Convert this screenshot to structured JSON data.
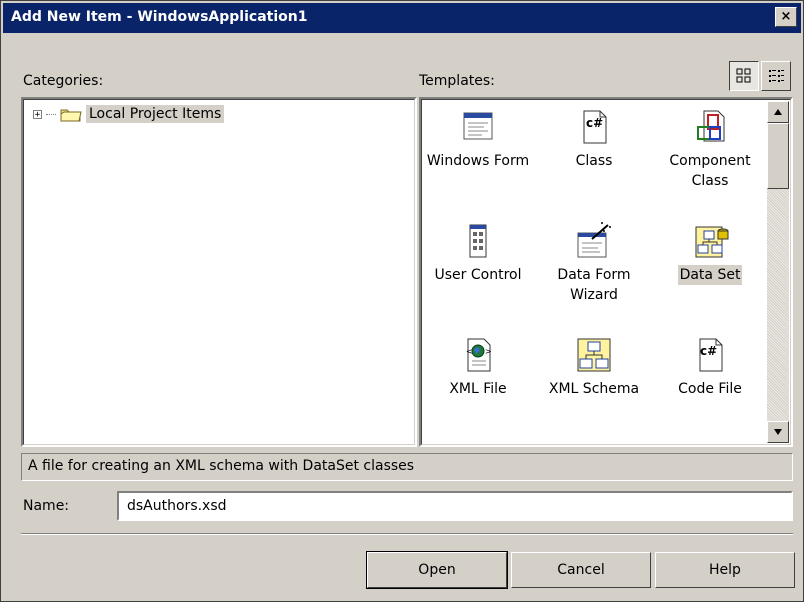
{
  "window": {
    "title": "Add New Item - WindowsApplication1",
    "close_label": "×"
  },
  "categories": {
    "label": "Categories:",
    "items": [
      {
        "label": "Local Project Items",
        "expander": "+",
        "icon": "folder-icon"
      }
    ]
  },
  "templates": {
    "label": "Templates:",
    "view_buttons": [
      {
        "name": "large-icons-view",
        "icon": "large-icons-view-icon"
      },
      {
        "name": "small-icons-view",
        "icon": "small-icons-view-icon"
      }
    ],
    "items": [
      {
        "label": "Windows Form",
        "icon": "windows-form-icon"
      },
      {
        "label": "Class",
        "icon": "csharp-class-icon"
      },
      {
        "label": "Component Class",
        "icon": "component-class-icon"
      },
      {
        "label": "User Control",
        "icon": "user-control-icon"
      },
      {
        "label": "Data Form Wizard",
        "icon": "data-form-wizard-icon"
      },
      {
        "label": "Data Set",
        "icon": "data-set-icon",
        "selected": true
      },
      {
        "label": "XML File",
        "icon": "xml-file-icon"
      },
      {
        "label": "XML Schema",
        "icon": "xml-schema-icon"
      },
      {
        "label": "Code File",
        "icon": "code-file-icon"
      }
    ]
  },
  "description": "A file for creating an XML schema with DataSet classes",
  "name_field": {
    "label": "Name:",
    "value": "dsAuthors.xsd"
  },
  "buttons": {
    "open": "Open",
    "cancel": "Cancel",
    "help": "Help"
  },
  "colors": {
    "titlebar": "#0a246a",
    "face": "#d4d0c8"
  }
}
